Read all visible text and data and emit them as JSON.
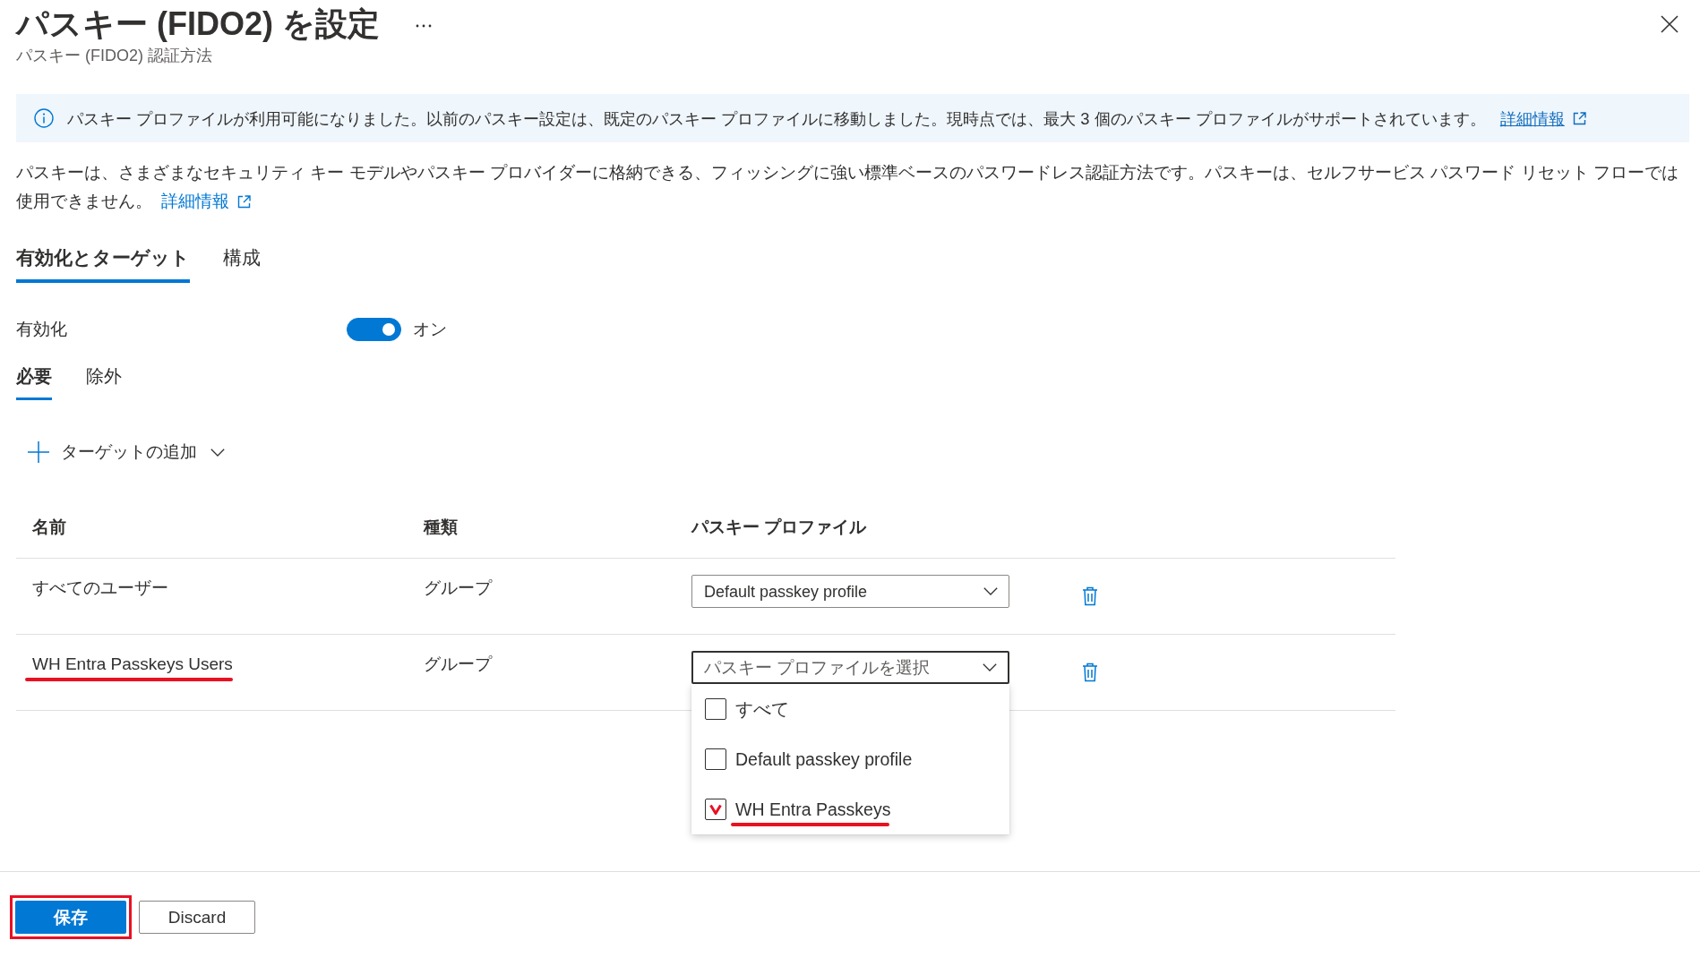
{
  "header": {
    "title": "パスキー (FIDO2) を設定",
    "subtitle": "パスキー (FIDO2) 認証方法"
  },
  "info_banner": {
    "text": "パスキー プロファイルが利用可能になりました。以前のパスキー設定は、既定のパスキー プロファイルに移動しました。現時点では、最大 3 個のパスキー プロファイルがサポートされています。",
    "link": "詳細情報"
  },
  "description": {
    "text": "パスキーは、さまざまなセキュリティ キー モデルやパスキー プロバイダーに格納できる、フィッシングに強い標準ベースのパスワードレス認証方法です。パスキーは、セルフサービス パスワード リセット フローでは使用できません。",
    "link": "詳細情報"
  },
  "tabs": [
    {
      "label": "有効化とターゲット",
      "selected": true
    },
    {
      "label": "構成",
      "selected": false
    }
  ],
  "enable": {
    "label": "有効化",
    "on": true,
    "state_label": "オン"
  },
  "target_tabs": [
    {
      "label": "必要",
      "selected": true
    },
    {
      "label": "除外",
      "selected": false
    }
  ],
  "add_target": {
    "label": "ターゲットの追加"
  },
  "table": {
    "columns": [
      "名前",
      "種類",
      "パスキー プロファイル"
    ],
    "rows": [
      {
        "name": "すべてのユーザー",
        "type": "グループ",
        "marked": false,
        "profile": {
          "value": "Default passkey profile",
          "open": false
        }
      },
      {
        "name": "WH Entra Passkeys Users",
        "type": "グループ",
        "marked": true,
        "profile": {
          "placeholder": "パスキー プロファイルを選択",
          "open": true,
          "options": [
            {
              "label": "すべて",
              "checked": false,
              "marked": false
            },
            {
              "label": "Default passkey profile",
              "checked": false,
              "marked": false
            },
            {
              "label": "WH Entra Passkeys",
              "checked": true,
              "marked": true
            }
          ]
        }
      }
    ]
  },
  "footer": {
    "buttons": [
      {
        "label": "保存",
        "kind": "primary",
        "marked": true
      },
      {
        "label": "Discard",
        "kind": "secondary",
        "marked": false
      }
    ]
  }
}
